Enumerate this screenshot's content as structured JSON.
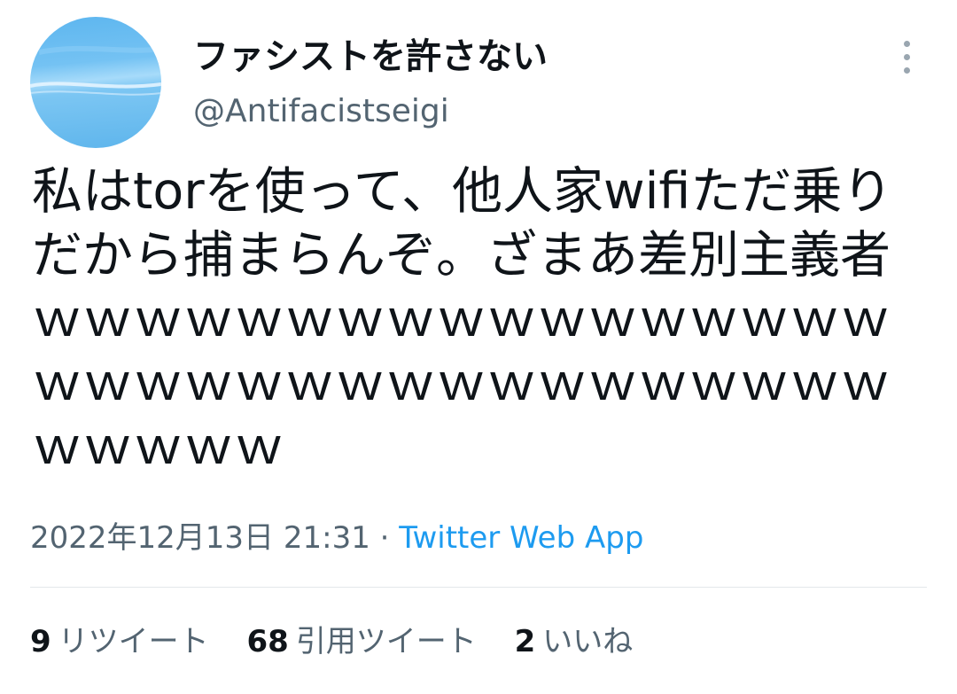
{
  "user": {
    "display_name": "ファシストを許さない",
    "handle": "@Antifacistseigi",
    "avatar_icon": "sky-avatar"
  },
  "tweet": {
    "text": "私はtorを使って、他人家wifiただ乗りだから捕まらんぞ。ざまあ差別主義者ｗｗｗｗｗｗｗｗｗｗｗｗｗｗｗｗｗｗｗｗｗｗｗｗｗｗｗｗｗｗｗｗｗｗｗｗｗｗｗ",
    "timestamp": "2022年12月13日 21:31",
    "separator": "·",
    "source": "Twitter Web App"
  },
  "stats": {
    "retweets_count": "9",
    "retweets_label": "リツイート",
    "quotes_count": "68",
    "quotes_label": "引用ツイート",
    "likes_count": "2",
    "likes_label": "いいね"
  },
  "colors": {
    "accent": "#1d9bf0",
    "secondary_text": "#536471",
    "primary_text": "#0f1419"
  },
  "icons": {
    "more": "more-vertical-icon"
  }
}
